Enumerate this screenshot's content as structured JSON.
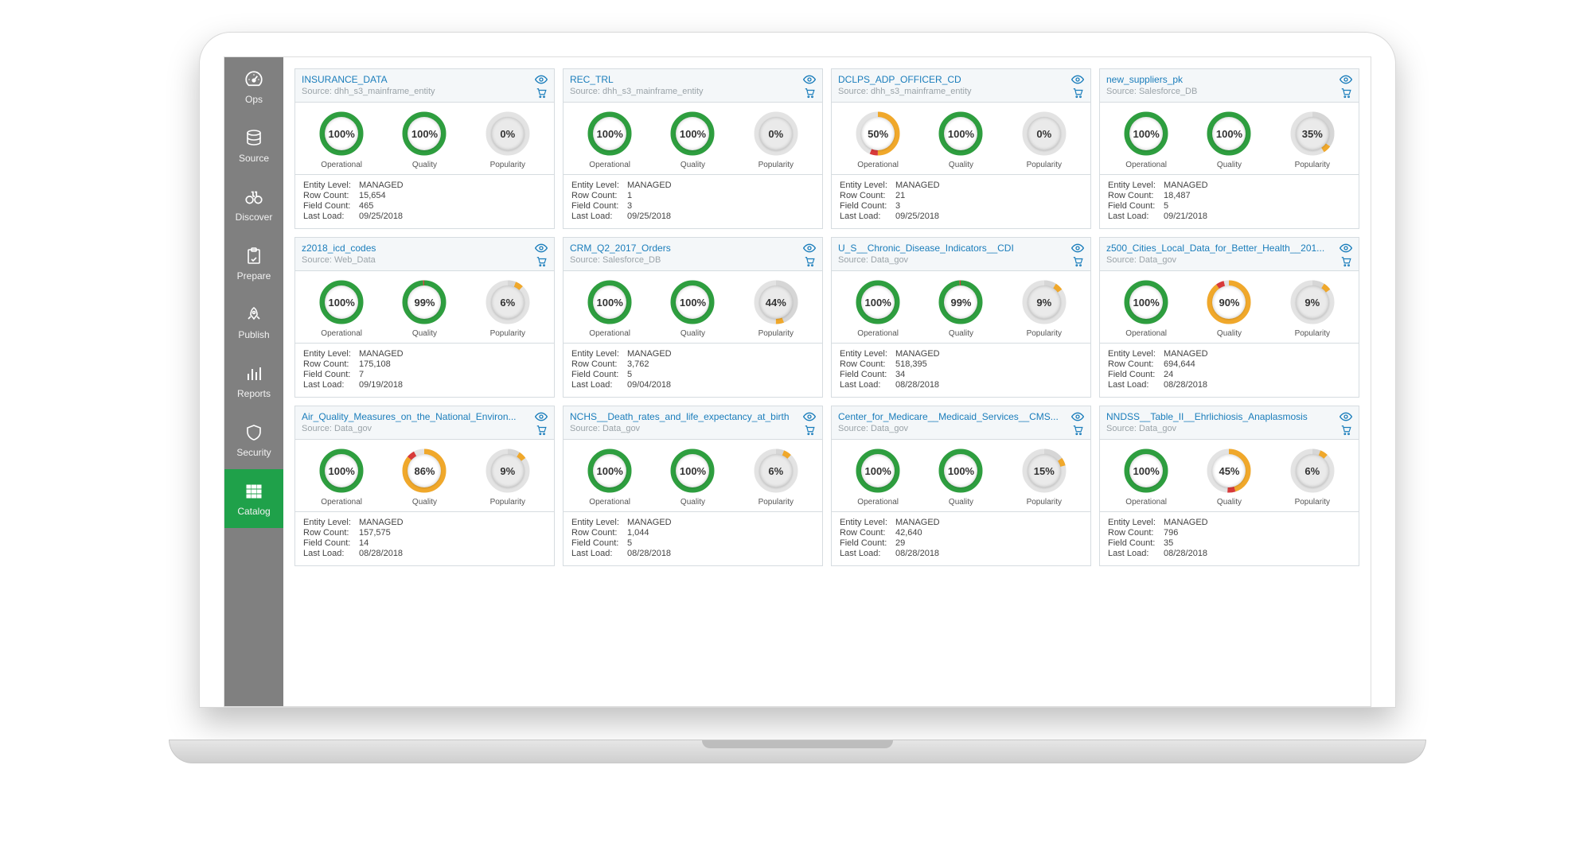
{
  "sidebar": {
    "items": [
      {
        "label": "Ops"
      },
      {
        "label": "Source"
      },
      {
        "label": "Discover"
      },
      {
        "label": "Prepare"
      },
      {
        "label": "Publish"
      },
      {
        "label": "Reports"
      },
      {
        "label": "Security"
      },
      {
        "label": "Catalog"
      }
    ]
  },
  "labels": {
    "source_prefix": "Source: ",
    "operational": "Operational",
    "quality": "Quality",
    "popularity": "Popularity",
    "entity_level": "Entity Level:",
    "row_count": "Row Count:",
    "field_count": "Field Count:",
    "last_load": "Last Load:"
  },
  "cards": [
    {
      "title": "INSURANCE_DATA",
      "source": "dhh_s3_mainframe_entity",
      "operational": 100,
      "quality": 100,
      "popularity": 0,
      "entity_level": "MANAGED",
      "row_count": "15,654",
      "field_count": "465",
      "last_load": "09/25/2018"
    },
    {
      "title": "REC_TRL",
      "source": "dhh_s3_mainframe_entity",
      "operational": 100,
      "quality": 100,
      "popularity": 0,
      "entity_level": "MANAGED",
      "row_count": "1",
      "field_count": "3",
      "last_load": "09/25/2018"
    },
    {
      "title": "DCLPS_ADP_OFFICER_CD",
      "source": "dhh_s3_mainframe_entity",
      "operational": 50,
      "quality": 100,
      "popularity": 0,
      "entity_level": "MANAGED",
      "row_count": "21",
      "field_count": "3",
      "last_load": "09/25/2018"
    },
    {
      "title": "new_suppliers_pk",
      "source": "Salesforce_DB",
      "operational": 100,
      "quality": 100,
      "popularity": 35,
      "entity_level": "MANAGED",
      "row_count": "18,487",
      "field_count": "5",
      "last_load": "09/21/2018"
    },
    {
      "title": "z2018_icd_codes",
      "source": "Web_Data",
      "operational": 100,
      "quality": 99,
      "popularity": 6,
      "entity_level": "MANAGED",
      "row_count": "175,108",
      "field_count": "7",
      "last_load": "09/19/2018"
    },
    {
      "title": "CRM_Q2_2017_Orders",
      "source": "Salesforce_DB",
      "operational": 100,
      "quality": 100,
      "popularity": 44,
      "entity_level": "MANAGED",
      "row_count": "3,762",
      "field_count": "5",
      "last_load": "09/04/2018"
    },
    {
      "title": "U_S__Chronic_Disease_Indicators__CDI",
      "source": "Data_gov",
      "operational": 100,
      "quality": 99,
      "popularity": 9,
      "entity_level": "MANAGED",
      "row_count": "518,395",
      "field_count": "34",
      "last_load": "08/28/2018"
    },
    {
      "title": "z500_Cities_Local_Data_for_Better_Health__201...",
      "source": "Data_gov",
      "operational": 100,
      "quality": 90,
      "popularity": 9,
      "entity_level": "MANAGED",
      "row_count": "694,644",
      "field_count": "24",
      "last_load": "08/28/2018"
    },
    {
      "title": "Air_Quality_Measures_on_the_National_Environ...",
      "source": "Data_gov",
      "operational": 100,
      "quality": 86,
      "popularity": 9,
      "entity_level": "MANAGED",
      "row_count": "157,575",
      "field_count": "14",
      "last_load": "08/28/2018"
    },
    {
      "title": "NCHS__Death_rates_and_life_expectancy_at_birth",
      "source": "Data_gov",
      "operational": 100,
      "quality": 100,
      "popularity": 6,
      "entity_level": "MANAGED",
      "row_count": "1,044",
      "field_count": "5",
      "last_load": "08/28/2018"
    },
    {
      "title": "Center_for_Medicare__Medicaid_Services__CMS...",
      "source": "Data_gov",
      "operational": 100,
      "quality": 100,
      "popularity": 15,
      "entity_level": "MANAGED",
      "row_count": "42,640",
      "field_count": "29",
      "last_load": "08/28/2018"
    },
    {
      "title": "NNDSS__Table_II__Ehrlichiosis_Anaplasmosis",
      "source": "Data_gov",
      "operational": 100,
      "quality": 45,
      "popularity": 6,
      "entity_level": "MANAGED",
      "row_count": "796",
      "field_count": "35",
      "last_load": "08/28/2018"
    }
  ]
}
